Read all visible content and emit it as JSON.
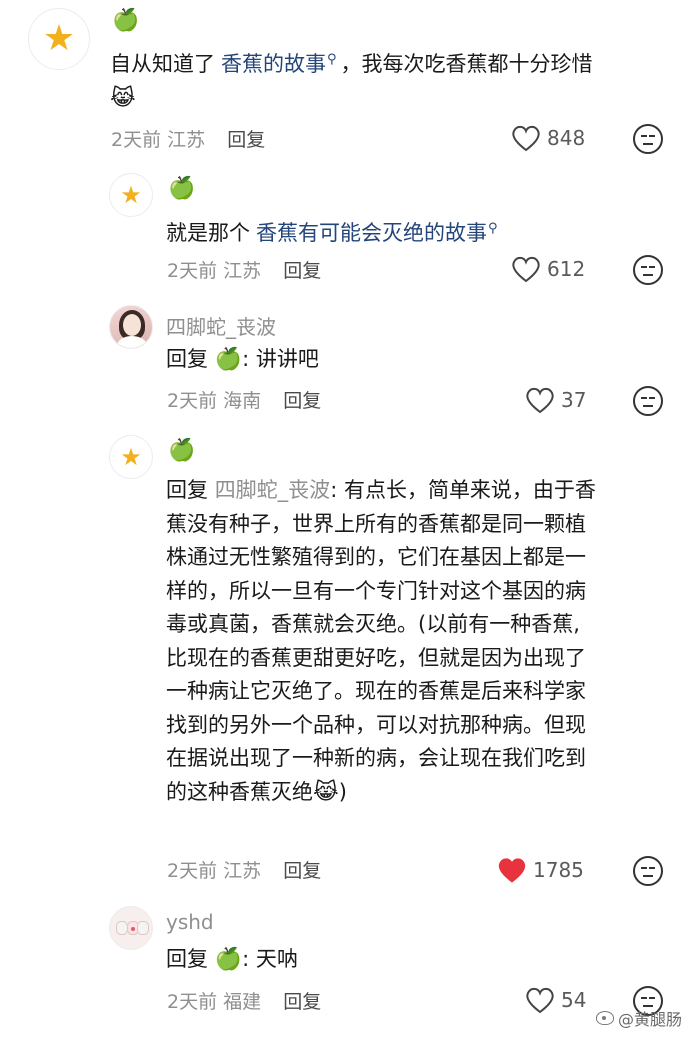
{
  "comments": [
    {
      "author": "🍏",
      "text_before": "自从知道了",
      "link": "香蕉的故事",
      "text_after": "，我每次吃香蕉都十分珍惜",
      "emoji": "😹",
      "time": "2天前",
      "location": "江苏",
      "reply_label": "回复",
      "likes": "848"
    },
    {
      "author": "🍏",
      "text_before": "就是那个",
      "link": "香蕉有可能会灭绝的故事",
      "time": "2天前",
      "location": "江苏",
      "reply_label": "回复",
      "likes": "612"
    },
    {
      "author": "四脚蛇_丧波",
      "reply_prefix": "回复",
      "reply_to": "🍏",
      "text": ": 讲讲吧",
      "time": "2天前",
      "location": "海南",
      "reply_label": "回复",
      "likes": "37"
    },
    {
      "author": "🍏",
      "reply_prefix": "回复",
      "reply_to": "四脚蛇_丧波",
      "text_lines": [
        ": 有点长，简单来说，由于香",
        "蕉没有种子，世界上所有的香蕉都是同一颗植",
        "株通过无性繁殖得到的，它们在基因上都是一",
        "样的，所以一旦有一个专门针对这个基因的病",
        "毒或真菌，香蕉就会灭绝。(以前有一种香蕉,",
        "比现在的香蕉更甜更好吃，但就是因为出现了",
        "一种病让它灭绝了。现在的香蕉是后来科学家",
        "找到的另外一个品种，可以对抗那种病。但现",
        "在据说出现了一种新的病，会让现在我们吃到",
        "的这种香蕉灭绝"
      ],
      "emoji": "😹",
      "closing": ")",
      "time": "2天前",
      "location": "江苏",
      "reply_label": "回复",
      "likes": "1785",
      "liked": true
    },
    {
      "author": "yshd",
      "reply_prefix": "回复",
      "reply_to": "🍏",
      "text": ": 天呐",
      "time": "2天前",
      "location": "福建",
      "reply_label": "回复",
      "likes": "54"
    }
  ],
  "colors": {
    "like_active": "#e8333f",
    "link": "#24457a",
    "meta": "#8f8f8f"
  },
  "watermark": "@黄腿肠"
}
